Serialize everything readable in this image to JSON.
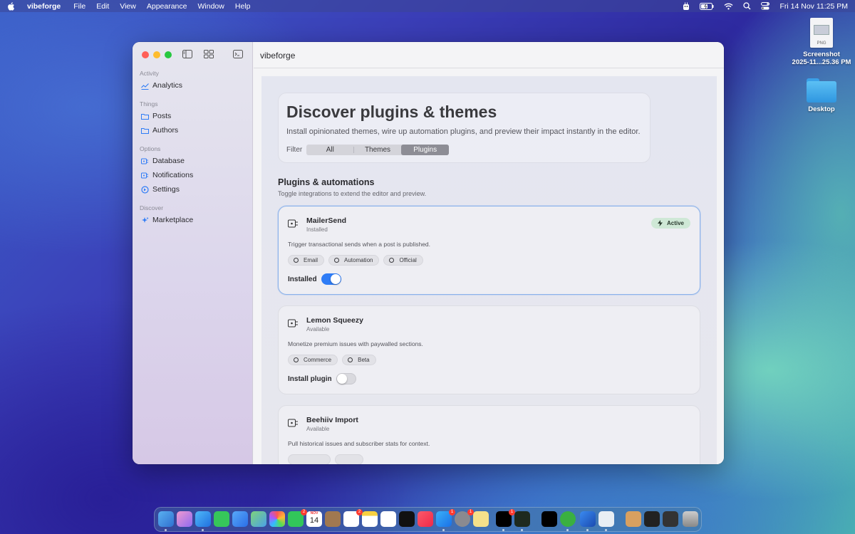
{
  "menubar": {
    "app_name": "vibeforge",
    "menus": [
      "File",
      "Edit",
      "View",
      "Appearance",
      "Window",
      "Help"
    ],
    "clock": "Fri 14 Nov  11:25 PM"
  },
  "desktop": {
    "screenshot_label": "Screenshot\n2025-11...25.36 PM",
    "screenshot_label_line1": "Screenshot",
    "screenshot_label_line2": "2025-11...25.36 PM",
    "file_type": "PNG",
    "folder_label": "Desktop"
  },
  "window": {
    "title": "vibeforge",
    "sidebar": {
      "sections": [
        {
          "title": "Activity",
          "items": [
            {
              "label": "Analytics",
              "icon": "chart-icon"
            }
          ]
        },
        {
          "title": "Things",
          "items": [
            {
              "label": "Posts",
              "icon": "folder-icon"
            },
            {
              "label": "Authors",
              "icon": "folder-icon"
            }
          ]
        },
        {
          "title": "Options",
          "items": [
            {
              "label": "Database",
              "icon": "plug-icon"
            },
            {
              "label": "Notifications",
              "icon": "plug-icon"
            },
            {
              "label": "Settings",
              "icon": "gear-icon"
            }
          ]
        },
        {
          "title": "Discover",
          "items": [
            {
              "label": "Marketplace",
              "icon": "sparkle-icon"
            }
          ]
        }
      ]
    },
    "hero": {
      "title": "Discover plugins & themes",
      "description": "Install opinionated themes, wire up automation plugins, and preview their impact instantly in the editor.",
      "filter_label": "Filter",
      "filters": [
        "All",
        "Themes",
        "Plugins"
      ],
      "selected_filter": "Plugins"
    },
    "section": {
      "title": "Plugins & automations",
      "subtitle": "Toggle integrations to extend the editor and preview."
    },
    "plugins": [
      {
        "name": "MailerSend",
        "status": "Installed",
        "description": "Trigger transactional sends when a post is published.",
        "tags": [
          "Email",
          "Automation",
          "Official"
        ],
        "toggle_label": "Installed",
        "toggle_on": true,
        "badge": "Active"
      },
      {
        "name": "Lemon Squeezy",
        "status": "Available",
        "description": "Monetize premium issues with paywalled sections.",
        "tags": [
          "Commerce",
          "Beta"
        ],
        "toggle_label": "Install plugin",
        "toggle_on": false
      },
      {
        "name": "Beehiiv Import",
        "status": "Available",
        "description": "Pull historical issues and subscriber stats for context.",
        "tags": []
      }
    ]
  },
  "dock": {
    "calendar_month": "NOV",
    "calendar_day": "14",
    "badges": [
      "2",
      "2",
      "1",
      "1",
      "1"
    ]
  },
  "colors": {
    "accent": "#2e7cf6",
    "active_badge": "#cfe8d6",
    "selected_border": "#8cb2ea"
  }
}
